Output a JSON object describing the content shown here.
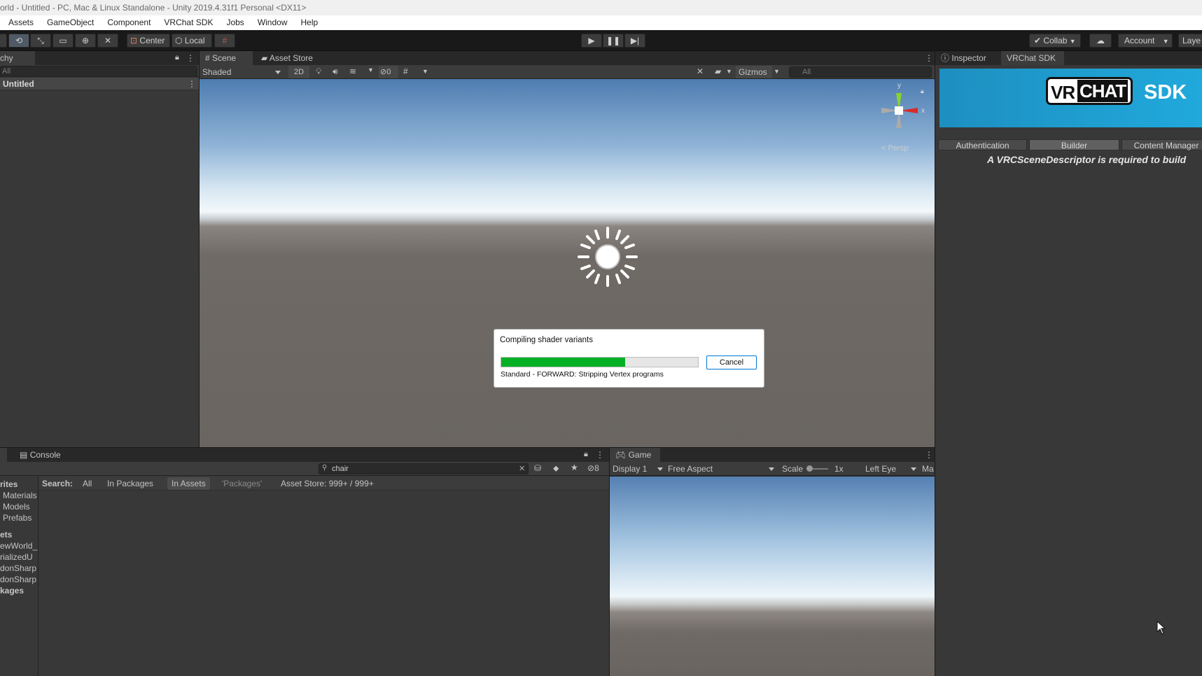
{
  "window": {
    "title": "orld - Untitled - PC, Mac & Linux Standalone - Unity 2019.4.31f1 Personal <DX11>"
  },
  "menu": [
    "Assets",
    "GameObject",
    "Component",
    "VRChat SDK",
    "Jobs",
    "Window",
    "Help"
  ],
  "toolbar": {
    "center_label": "Center",
    "local_label": "Local",
    "collab_label": "Collab",
    "account_label": "Account",
    "layers_label": "Laye"
  },
  "hierarchy": {
    "tab_label": "chy",
    "search_placeholder": "All",
    "scene_name": "Untitled"
  },
  "scene": {
    "tabs": {
      "scene": "Scene",
      "asset_store": "Asset Store"
    },
    "shading_mode": "Shaded",
    "two_d_label": "2D",
    "hidden_count": "0",
    "gizmos_label": "Gizmos",
    "search_placeholder": "All",
    "gizmo_y": "y",
    "gizmo_x": "x",
    "persp_label": "< Persp"
  },
  "dialog": {
    "title": "Compiling shader variants",
    "progress": 0.63,
    "status": "Standard - FORWARD: Stripping Vertex programs",
    "cancel_label": "Cancel"
  },
  "inspector": {
    "tab_inspector": "Inspector",
    "tab_vrchat": "VRChat SDK",
    "banner_vr": "VR",
    "banner_chat": "CHAT",
    "banner_sdk": "SDK",
    "tabs": [
      "Authentication",
      "Builder",
      "Content Manager"
    ],
    "selected_tab": "Builder",
    "message": "A VRCSceneDescriptor is required to build"
  },
  "console": {
    "tab_label": "Console",
    "search_value": "chair",
    "hidden_count": "8",
    "filter_label": "Search:",
    "filters": [
      "All",
      "In Packages",
      "In Assets",
      "'Packages'"
    ],
    "asset_store_label": "Asset Store: 999+ / 999+"
  },
  "project_tree": {
    "favorites_header": "rites",
    "favorites": [
      "Materials",
      "Models",
      "Prefabs"
    ],
    "assets_header": "ets",
    "assets": [
      "ewWorld_I",
      "rializedU",
      "donSharp",
      "donSharp"
    ],
    "packages_header": "kages"
  },
  "game": {
    "tab_label": "Game",
    "display": "Display 1",
    "aspect": "Free Aspect",
    "scale_label": "Scale",
    "scale_value": "1x",
    "eye": "Left Eye",
    "maximize_label": "Ma"
  },
  "colors": {
    "progress_fill": "#06b025",
    "vrchat_banner": "#1ea6d6",
    "selected_tab": "#606060"
  }
}
